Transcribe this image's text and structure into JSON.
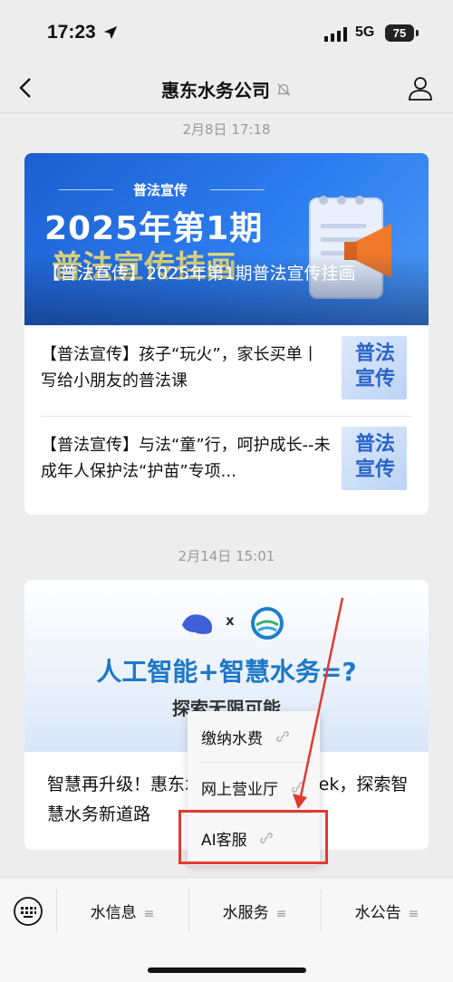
{
  "status": {
    "time": "17:23",
    "network": "5G",
    "battery": "75"
  },
  "header": {
    "title": "惠东水务公司"
  },
  "messages": [
    {
      "timestamp": "2月8日 17:18",
      "cover": {
        "kicker": "普法宣传",
        "headline": "2025年第1期",
        "headline2": "普法宣传挂画",
        "title": "【普法宣传】2025年第1期普法宣传挂画"
      },
      "items": [
        {
          "text": "【普法宣传】孩子“玩火”，家长买单丨写给小朋友的普法课",
          "thumb": "普法宣传"
        },
        {
          "text": "【普法宣传】与法“童”行，呵护成长--未成年人保护法“护苗”专项...",
          "thumb": "普法宣传"
        }
      ]
    },
    {
      "timestamp": "2月14日 15:01",
      "cover": {
        "x": "x",
        "headline": "人工智能+智慧水务=?",
        "sub": "探索无限可能"
      },
      "text": "智慧再升级！惠东水务部署Deepseek，探索智慧水务新道路"
    }
  ],
  "popup_menu": {
    "items": [
      "缴纳水费",
      "网上营业厅",
      "AI客服"
    ]
  },
  "tabbar": {
    "tabs": [
      "水信息",
      "水服务",
      "水公告"
    ],
    "menu_icon": "≡"
  },
  "colors": {
    "accent_blue": "#2d7df0",
    "highlight_red": "#e23a2f"
  }
}
